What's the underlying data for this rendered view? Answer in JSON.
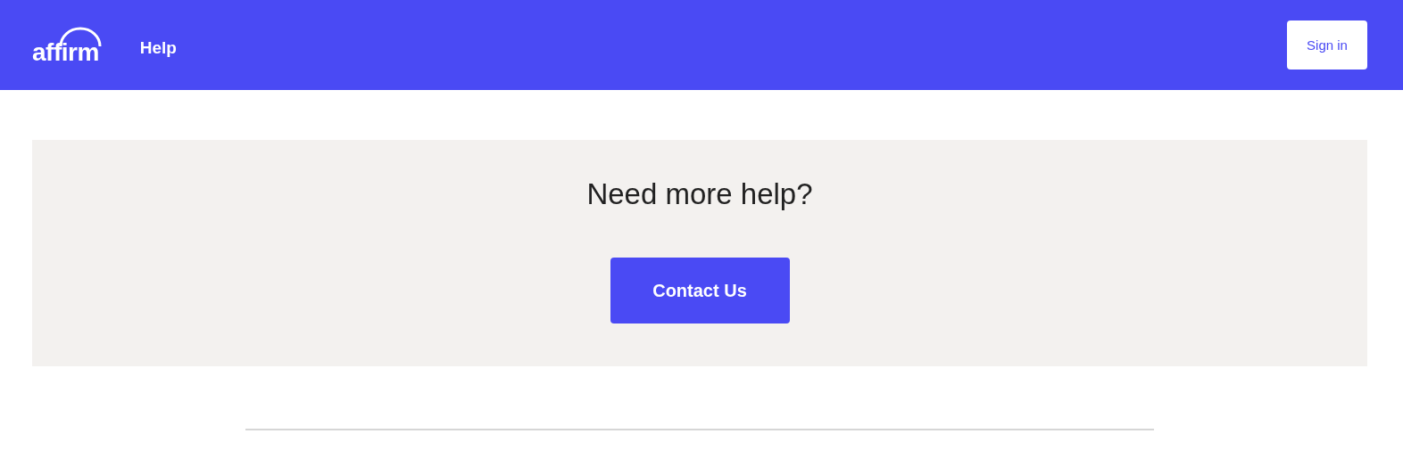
{
  "header": {
    "logo": "affirm",
    "nav_link": "Help",
    "sign_in_button": "Sign in"
  },
  "help_panel": {
    "title": "Need more help?",
    "contact_button": "Contact Us"
  }
}
